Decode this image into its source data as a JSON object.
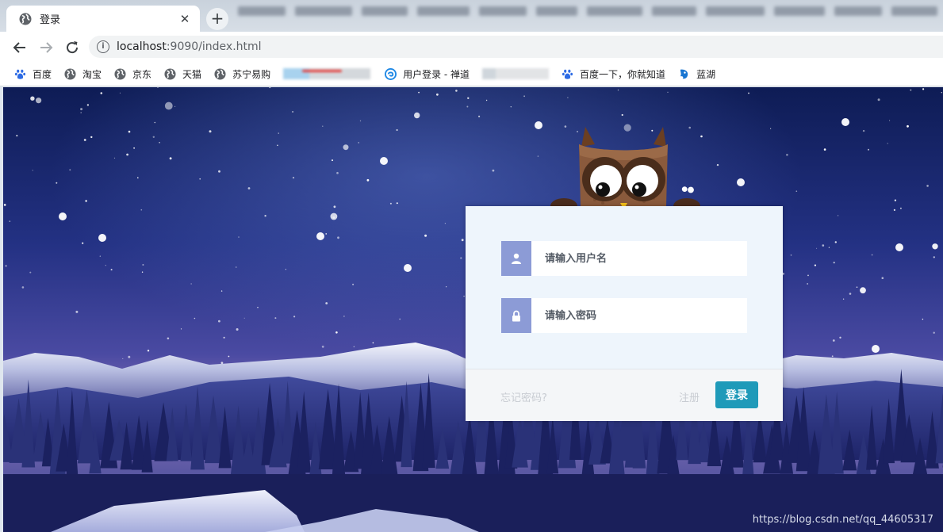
{
  "browser": {
    "tab_title": "登录",
    "tab_close": "✕",
    "new_tab": "+",
    "url_host": "localhost",
    "url_path": ":9090/index.html"
  },
  "bookmarks": {
    "items": [
      "百度",
      "淘宝",
      "京东",
      "天猫",
      "苏宁易购",
      "用户登录 - 禅道",
      "百度一下，你就知道",
      "蓝湖"
    ]
  },
  "login": {
    "username_placeholder": "请输入用户名",
    "password_placeholder": "请输入密码",
    "forgot_label": "忘记密码?",
    "register_label": "注册",
    "submit_label": "登录"
  },
  "watermark": "https://blog.csdn.net/qq_44605317",
  "colors": {
    "icon_bg": "#8c9bd6",
    "submit_bg": "#1f9ab9",
    "panel_bg": "#eef5fc"
  }
}
